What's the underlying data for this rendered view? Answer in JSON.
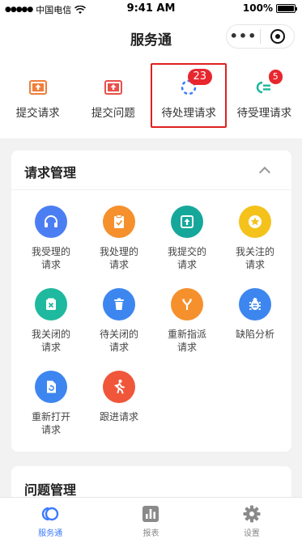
{
  "status_bar": {
    "carrier": "中国电信",
    "time": "9:41 AM",
    "battery": "100%"
  },
  "nav": {
    "title": "服务通",
    "more_icon": "more-dots-icon",
    "close_icon": "target-close-icon"
  },
  "quick_actions": [
    {
      "label": "提交请求",
      "icon": "upload-tray-icon",
      "color": "#f07d3a"
    },
    {
      "label": "提交问题",
      "icon": "upload-tray-icon",
      "color": "#e8504a"
    },
    {
      "label": "待处理请求",
      "icon": "loading-spinner-icon",
      "color": "#3a7afe",
      "badge": "23"
    },
    {
      "label": "待受理请求",
      "icon": "list-indent-icon",
      "color": "#1fb7a0",
      "badge": "5"
    }
  ],
  "request_card": {
    "title": "请求管理",
    "items": [
      {
        "line1": "我受理的",
        "line2": "请求",
        "icon": "headset-icon",
        "color": "#4c7ef3"
      },
      {
        "line1": "我处理的",
        "line2": "请求",
        "icon": "clipboard-check-icon",
        "color": "#f5902c"
      },
      {
        "line1": "我提交的",
        "line2": "请求",
        "icon": "submit-box-icon",
        "color": "#16a79b"
      },
      {
        "line1": "我关注的",
        "line2": "请求",
        "icon": "star-icon",
        "color": "#f4c21b"
      },
      {
        "line1": "我关闭的",
        "line2": "请求",
        "icon": "close-doc-icon",
        "color": "#1fb99f"
      },
      {
        "line1": "待关闭的",
        "line2": "请求",
        "icon": "trash-icon",
        "color": "#3d86f0"
      },
      {
        "line1": "重新指派",
        "line2": "请求",
        "icon": "fork-icon",
        "color": "#f5902c"
      },
      {
        "line1": "缺陷分析",
        "line2": "",
        "icon": "bug-icon",
        "color": "#3d86f0"
      },
      {
        "line1": "重新打开",
        "line2": "请求",
        "icon": "reopen-file-icon",
        "color": "#3d86f0"
      },
      {
        "line1": "跟进请求",
        "line2": "",
        "icon": "runner-icon",
        "color": "#f0563a"
      }
    ]
  },
  "problem_card": {
    "title": "问题管理"
  },
  "tabs": [
    {
      "label": "服务通",
      "icon": "service-logo-icon",
      "active": true
    },
    {
      "label": "报表",
      "icon": "bar-chart-icon",
      "active": false
    },
    {
      "label": "设置",
      "icon": "gear-icon",
      "active": false
    }
  ]
}
